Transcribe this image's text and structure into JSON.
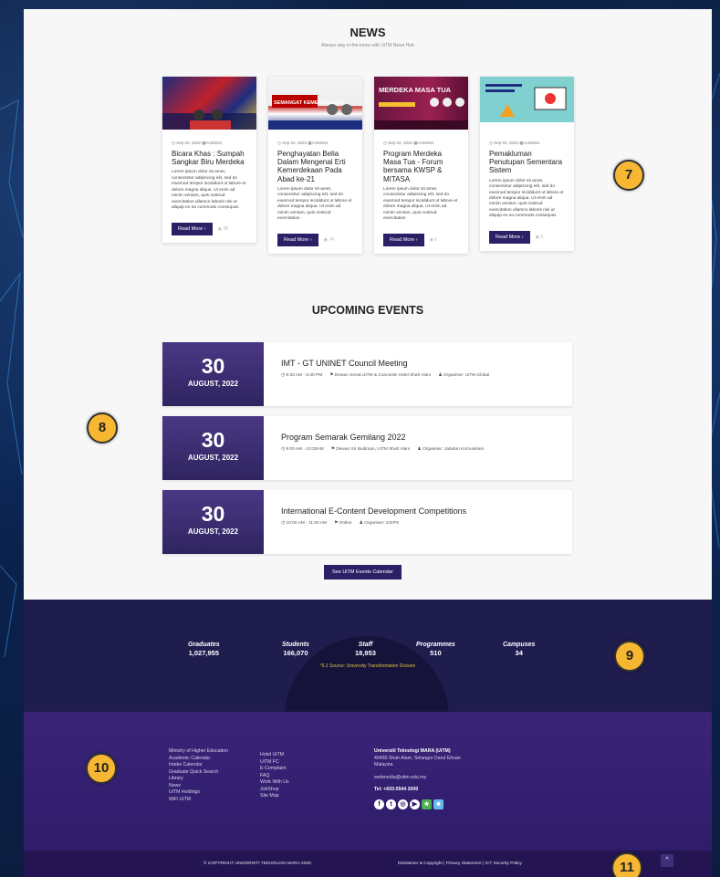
{
  "news": {
    "title": "NEWS",
    "subtitle": "Always stay in-the-know with UiTM News Hub",
    "cards": [
      {
        "date": "Sep 02, 2022",
        "category": "Activities",
        "title": "Bicara Khas : Sumpah Sangkar Biru Merdeka",
        "body": "Lorem ipsum dolor sit amet, consectetur adipiscing elit, sed do eiusmod tempor incididunt ut labore et dolore magna aliqua. Ut enim ad minim veniam, quis nostrud exercitation ullamco laboris nisi ut aliquip ex ea commodo consequat.",
        "button": "Read More ›",
        "views": "38",
        "accent": "#c0202a"
      },
      {
        "date": "Sep 02, 2022",
        "category": "Activities",
        "title": "Penghayatan Belia Dalam Mengenal Erti Kemerdekaan Pada Abad ke-21",
        "body": "Lorem ipsum dolor sit amet, consectetur adipiscing elit, sed do eiusmod tempor incididunt ut labore et dolore magna aliqua. Ut enim ad minim veniam, quis nostrud exercitation",
        "button": "Read More ›",
        "views": "74",
        "accent": "#e03030"
      },
      {
        "date": "Sep 02, 2022",
        "category": "Activities",
        "title": "Program Merdeka Masa Tua - Forum bersama KWSP & MITASA",
        "body": "Lorem ipsum dolor sit amet, consectetur adipiscing elit, sed do eiusmod tempor incididunt ut labore et dolore magna aliqua. Ut enim ad minim veniam, quis nostrud exercitation",
        "button": "Read More ›",
        "views": "6",
        "accent": "#7a1f4e"
      },
      {
        "date": "Sep 02, 2022",
        "category": "Activities",
        "title": "Pemakluman Penutupan Sementara Sistem",
        "body": "Lorem ipsum dolor sit amet, consectetur adipiscing elit, sed do eiusmod tempor incididunt ut labore et dolore magna aliqua. Ut enim ad minim veniam, quis nostrud exercitation ullamco laboris nisi ut aliquip ex ea commodo consequat.",
        "button": "Read More ›",
        "views": "0",
        "accent": "#6fc6c7"
      }
    ],
    "thumb_texts": [
      "",
      "SEMANGAT KEMERDEKAAN",
      "MERDEKA MASA TUA",
      ""
    ]
  },
  "events": {
    "title": "UPCOMING EVENTS",
    "items": [
      {
        "day": "30",
        "month": "AUGUST, 2022",
        "name": "IMT - GT UNINET Council Meeting",
        "time": "8:30 AM - 5:30 PM",
        "venue": "Dewan Senat UiTM & Concorde Hotel Shah Alam",
        "organiser": "Organiser: UiTM Global"
      },
      {
        "day": "30",
        "month": "AUGUST, 2022",
        "name": "Program Semarak Gemilang 2022",
        "time": "9:00 AM - 10:30AM",
        "venue": "Dewan Sri Budiman, UiTM Shah Alam",
        "organiser": "Organiser: Jabatan Komunikasi"
      },
      {
        "day": "30",
        "month": "AUGUST, 2022",
        "name": "International E-Content Development Competitions",
        "time": "10:00 AM - 11:00 AM",
        "venue": "Online",
        "organiser": "Organiser: iCEPS"
      }
    ],
    "calendar_button": "See UiTM Events Calendar"
  },
  "stats": {
    "items": [
      {
        "label": "Graduates",
        "value": "1,027,955"
      },
      {
        "label": "Students",
        "value": "166,070"
      },
      {
        "label": "Staff",
        "value": "18,953"
      },
      {
        "label": "Programmes",
        "value": "510"
      },
      {
        "label": "Campuses",
        "value": "34"
      }
    ],
    "source": "*6.1 Source: University Transformation Division"
  },
  "footer": {
    "col1": [
      "Ministry of Higher Education",
      "Academic Calendar",
      "Intake Calendar",
      "Graduate Quick Search",
      "Library",
      "News",
      "UiTM Holdings",
      "WiFi UiTM"
    ],
    "col2": [
      "Hotel UiTM",
      "UiTM FC",
      "E-Complaint",
      "FAQ",
      "Work With Us",
      "JobShop",
      "Site Map"
    ],
    "org_name": "Universiti Teknologi MARA (UiTM)",
    "address1": "40450 Shah Alam, Selangor Darul Ehsan",
    "address2": "Malaysia",
    "email": "webmedia@uitm.edu.my",
    "tel": "Tel: +603-5544 2000",
    "social": [
      "f",
      "t",
      "◎",
      "▶",
      "★",
      "■"
    ],
    "copyright": "© COPYRIGHT UNIVERSITI TEKNOLOGI MARA 2020.",
    "legal": "Disclaimer & Copyright | Privacy Statement | ICT Security Policy",
    "to_top": "^"
  },
  "markers": [
    "7",
    "8",
    "9",
    "10",
    "11"
  ]
}
